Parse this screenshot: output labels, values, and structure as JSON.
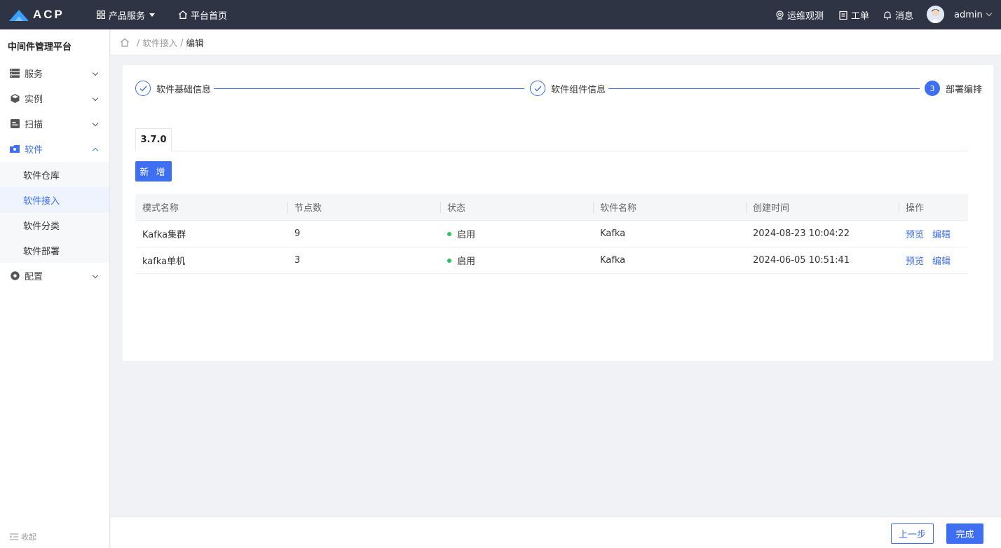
{
  "header": {
    "logo_text": "ACP",
    "nav": {
      "products": "产品服务",
      "home": "平台首页"
    },
    "right": {
      "ops": "运维观测",
      "ticket": "工单",
      "messages": "消息",
      "user": "admin"
    }
  },
  "sidebar": {
    "platform_title": "中间件管理平台",
    "menu": {
      "service": "服务",
      "instance": "实例",
      "scan": "扫描",
      "software": "软件",
      "config": "配置"
    },
    "software_children": {
      "repo": "软件仓库",
      "access": "软件接入",
      "category": "软件分类",
      "deploy": "软件部署"
    },
    "collapse_label": "收起"
  },
  "breadcrumb": {
    "parent": "软件接入",
    "current": "编辑",
    "sep": "/"
  },
  "steps": {
    "step1": {
      "label": "软件基础信息",
      "state": "done"
    },
    "step2": {
      "label": "软件组件信息",
      "state": "done"
    },
    "step3": {
      "number": "3",
      "label": "部署编排",
      "state": "active"
    }
  },
  "tabs": {
    "version": "3.7.0"
  },
  "toolbar": {
    "add_label": "新 增"
  },
  "table": {
    "columns": {
      "mode_name": "模式名称",
      "node_count": "节点数",
      "status": "状态",
      "software_name": "软件名称",
      "created_at": "创建时间",
      "actions": "操作"
    },
    "rows": [
      {
        "mode_name": "Kafka集群",
        "node_count": "9",
        "status": "启用",
        "software_name": "Kafka",
        "created_at": "2024-08-23 10:04:22",
        "preview": "预览",
        "edit": "编辑"
      },
      {
        "mode_name": "kafka单机",
        "node_count": "3",
        "status": "启用",
        "software_name": "Kafka",
        "created_at": "2024-06-05 10:51:41",
        "preview": "预览",
        "edit": "编辑"
      }
    ]
  },
  "footer": {
    "prev": "上一步",
    "done": "完成"
  },
  "colors": {
    "accent": "#3e6ef1",
    "header_bg": "#2f3444",
    "status_green": "#2fc25b"
  }
}
